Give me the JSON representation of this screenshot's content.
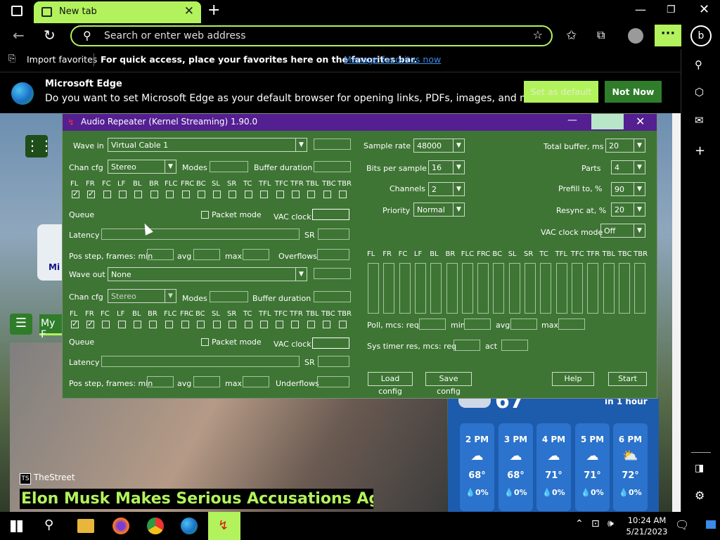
{
  "browser": {
    "tab_title": "New tab",
    "address_placeholder": "Search or enter web address",
    "favbar_import": "Import favorites",
    "favbar_hint": "For quick access, place your favorites here on the favorites bar.",
    "favbar_link": "Manage favorites now",
    "infobar_title": "Microsoft Edge",
    "infobar_text": "Do you want to set Microsoft Edge as your default browser for opening links, PDFs, images, and more?",
    "set_default": "Set as default",
    "not_now": "Not Now"
  },
  "page": {
    "myfeed": "My F",
    "sidecard": "Mi",
    "news_source": "TheStreet",
    "headline": "Elon Musk Makes Serious Accusations Against",
    "weather_temp": "67",
    "weather_note": "in 1 hour",
    "forecast": [
      {
        "hour": "2 PM",
        "temp": "68°",
        "precip": "0%"
      },
      {
        "hour": "3 PM",
        "temp": "68°",
        "precip": "0%"
      },
      {
        "hour": "4 PM",
        "temp": "71°",
        "precip": "0%"
      },
      {
        "hour": "5 PM",
        "temp": "71°",
        "precip": "0%"
      },
      {
        "hour": "6 PM",
        "temp": "72°",
        "precip": "0%"
      }
    ]
  },
  "dialog": {
    "title": "Audio Repeater (Kernel Streaming) 1.90.0",
    "wave_in_label": "Wave in",
    "wave_in": "Virtual Cable 1",
    "chan_cfg_label": "Chan cfg",
    "chan_cfg": "Stereo",
    "modes": "Modes",
    "buffer_duration": "Buffer duration",
    "channels": [
      "FL",
      "FR",
      "FC",
      "LF",
      "BL",
      "BR",
      "FLC",
      "FRC",
      "BC",
      "SL",
      "SR",
      "TC",
      "TFL",
      "TFC",
      "TFR",
      "TBL",
      "TBC",
      "TBR"
    ],
    "queue": "Queue",
    "packet_mode": "Packet mode",
    "vac_clock": "VAC clock",
    "latency": "Latency",
    "sr": "SR",
    "pos_step": "Pos step, frames: min",
    "avg": "avg",
    "max": "max",
    "overflows": "Overflows",
    "wave_out_label": "Wave out",
    "wave_out": "None",
    "chan_cfg2": "Stereo",
    "underflows": "Underflows",
    "sample_rate_label": "Sample rate",
    "sample_rate": "48000",
    "bits_label": "Bits per sample",
    "bits": "16",
    "channels_label": "Channels",
    "channels_val": "2",
    "priority_label": "Priority",
    "priority": "Normal",
    "total_buffer_label": "Total buffer, ms",
    "total_buffer": "20",
    "parts_label": "Parts",
    "parts": "4",
    "prefill_label": "Prefill to, %",
    "prefill": "90",
    "resync_label": "Resync at, %",
    "resync": "20",
    "vac_clock_mode_label": "VAC clock mode",
    "vac_clock_mode": "Off",
    "poll_label": "Poll, mcs:  req",
    "min": "min",
    "sys_timer_label": "Sys timer res, mcs:  req",
    "act": "act",
    "load_config": "Load config",
    "save_config": "Save config",
    "help": "Help",
    "start": "Start"
  },
  "taskbar": {
    "time": "10:24 AM",
    "date": "5/21/2023"
  }
}
